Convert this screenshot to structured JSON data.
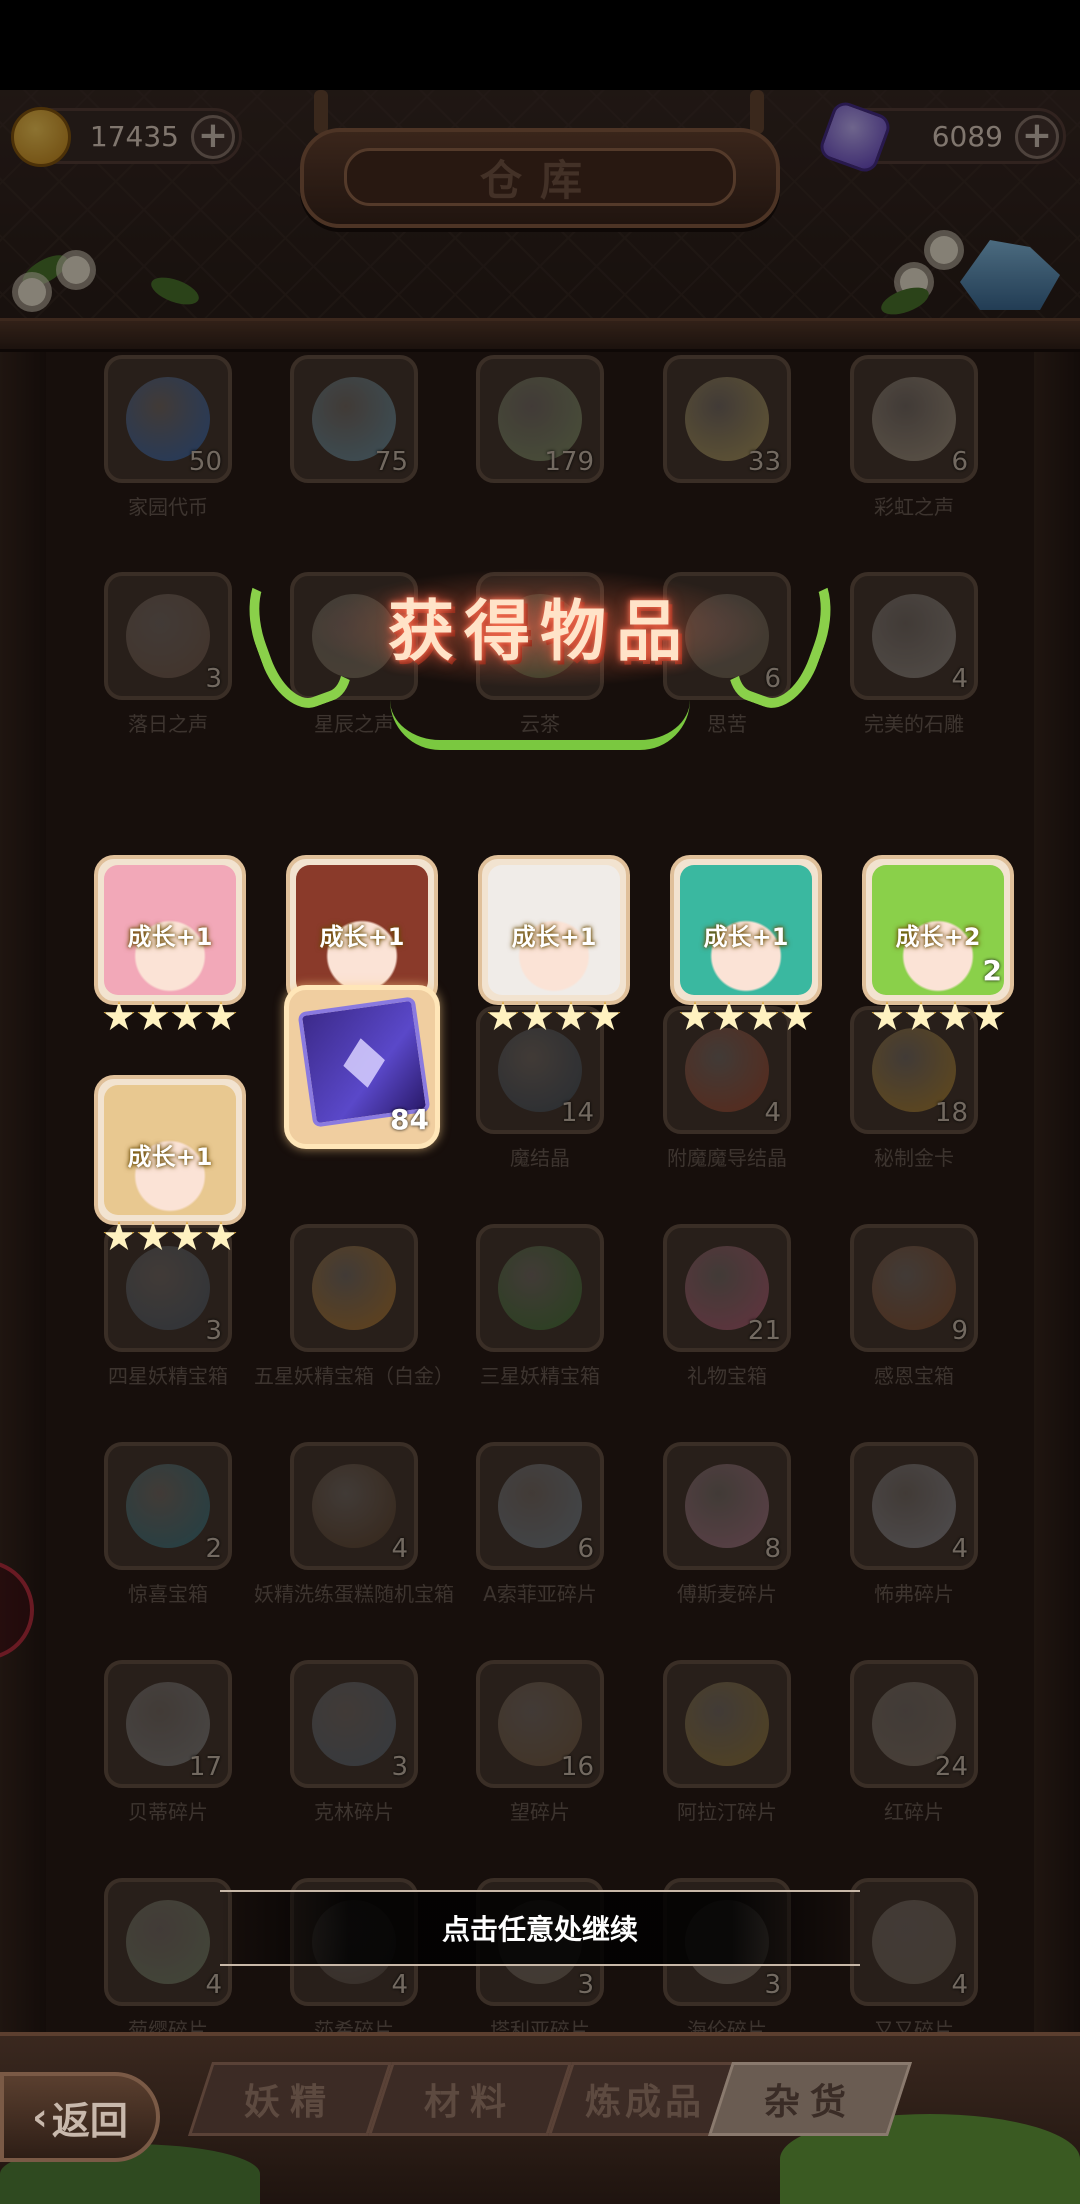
{
  "header": {
    "title": "仓库",
    "coins": "17435",
    "gems": "6089",
    "plus": "+"
  },
  "items": [
    {
      "label": "家园代币",
      "count": "50",
      "color": "#3a7ad8"
    },
    {
      "label": "",
      "count": "75",
      "color": "#7ab0c8"
    },
    {
      "label": "",
      "count": "179",
      "color": "#9ab07a"
    },
    {
      "label": "",
      "count": "33",
      "color": "#d8c070"
    },
    {
      "label": "彩虹之声",
      "count": "6",
      "color": "#c8b8a0"
    },
    {
      "label": "落日之声",
      "count": "3",
      "color": "#8a6a58"
    },
    {
      "label": "星辰之声",
      "count": "",
      "color": "#9a8a70"
    },
    {
      "label": "云茶",
      "count": "",
      "color": "#6a8a50"
    },
    {
      "label": "思苦",
      "count": "6",
      "color": "#8a7a60"
    },
    {
      "label": "完美的石雕",
      "count": "4",
      "color": "#b0a8a0"
    },
    {
      "label": "魔结晶",
      "count": "14",
      "color": "#4a5a6a"
    },
    {
      "label": "附魔魔导结晶",
      "count": "4",
      "color": "#c05030"
    },
    {
      "label": "秘制金卡",
      "count": "18",
      "color": "#d8a030"
    },
    {
      "label": "四星妖精宝箱",
      "count": "3",
      "color": "#5a6a7a"
    },
    {
      "label": "五星妖精宝箱（白金）",
      "count": "",
      "color": "#d89030"
    },
    {
      "label": "三星妖精宝箱",
      "count": "",
      "color": "#4a8a3a"
    },
    {
      "label": "礼物宝箱",
      "count": "21",
      "color": "#d86a8a"
    },
    {
      "label": "感恩宝箱",
      "count": "9",
      "color": "#a05a30"
    },
    {
      "label": "惊喜宝箱",
      "count": "2",
      "color": "#3a8a9a"
    },
    {
      "label": "妖精洗练蛋糕随机宝箱",
      "count": "4",
      "color": "#6a4a30"
    },
    {
      "label": "A索菲亚碎片",
      "count": "6",
      "color": "#8a9aa8"
    },
    {
      "label": "傅斯麦碎片",
      "count": "8",
      "color": "#c88aa0"
    },
    {
      "label": "怖弗碎片",
      "count": "4",
      "color": "#a8a8b0"
    },
    {
      "label": "贝蒂碎片",
      "count": "17",
      "color": "#9a9a9a"
    },
    {
      "label": "克林碎片",
      "count": "3",
      "color": "#6a7a8a"
    },
    {
      "label": "望碎片",
      "count": "16",
      "color": "#8a6a4a"
    },
    {
      "label": "阿拉汀碎片",
      "count": "",
      "color": "#b09040"
    },
    {
      "label": "红碎片",
      "count": "24",
      "color": "#9a8a7a"
    },
    {
      "label": "菊缨碎片",
      "count": "4",
      "color": "#8a9a7a"
    },
    {
      "label": "莎希碎片",
      "count": "4",
      "color": "#6a5a50"
    },
    {
      "label": "塔利亚碎片",
      "count": "3",
      "color": "#8a7a6a"
    },
    {
      "label": "海伦碎片",
      "count": "3",
      "color": "#9a8a7a"
    },
    {
      "label": "又又碎片",
      "count": "4",
      "color": "#8a7a6a"
    }
  ],
  "popup": {
    "title": "获得物品",
    "rewards": [
      {
        "badge": "成长+1",
        "count": "",
        "hair": "#f2a8b8"
      },
      {
        "badge": "成长+1",
        "count": "",
        "hair": "#8a3a2a"
      },
      {
        "badge": "成长+1",
        "count": "",
        "hair": "#f0ece8"
      },
      {
        "badge": "成长+1",
        "count": "",
        "hair": "#3ab8a0"
      },
      {
        "badge": "成长+2",
        "count": "2",
        "hair": "#8ad04a"
      },
      {
        "badge": "成长+1",
        "count": "",
        "hair": "#e8c890"
      }
    ],
    "card_count": "84",
    "continue_text": "点击任意处继续"
  },
  "tabs": [
    "妖精",
    "材料",
    "炼成品",
    "杂货"
  ],
  "active_tab": "杂货",
  "back_label": "返回"
}
